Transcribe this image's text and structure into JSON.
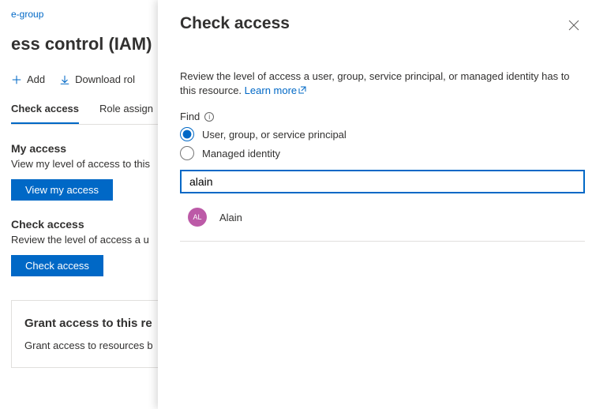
{
  "breadcrumb": "e-group",
  "pageTitle": "ess control (IAM)",
  "toolbar": {
    "add": "Add",
    "download": "Download rol"
  },
  "tabs": {
    "check": "Check access",
    "roleAssign": "Role assign"
  },
  "myAccess": {
    "heading": "My access",
    "body": "View my level of access to this",
    "button": "View my access"
  },
  "checkAccess": {
    "heading": "Check access",
    "body": "Review the level of access a u",
    "button": "Check access"
  },
  "grant": {
    "heading": "Grant access to this re",
    "body": "Grant access to resources b"
  },
  "panel": {
    "title": "Check access",
    "description": "Review the level of access a user, group, service principal, or managed identity has to this resource.",
    "learnMore": "Learn more",
    "findLabel": "Find",
    "radio1": "User, group, or service principal",
    "radio2": "Managed identity",
    "searchValue": "alain",
    "results": [
      {
        "initials": "AL",
        "name": "Alain"
      }
    ]
  }
}
